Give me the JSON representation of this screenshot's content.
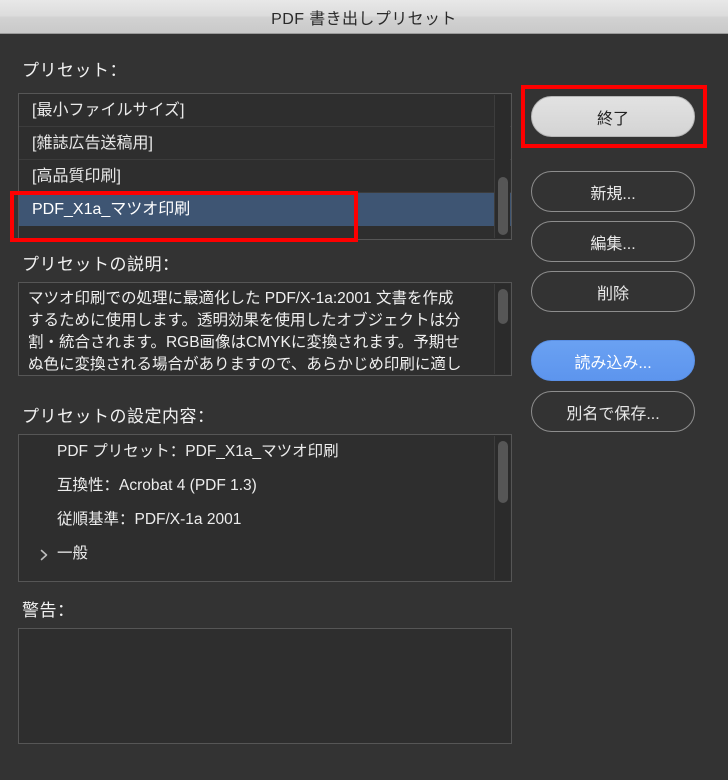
{
  "window": {
    "title": "PDF 書き出しプリセット"
  },
  "presets": {
    "label": "プリセット：",
    "items": [
      {
        "name": "[最小ファイルサイズ]",
        "selected": false
      },
      {
        "name": "[雑誌広告送稿用]",
        "selected": false
      },
      {
        "name": "[高品質印刷]",
        "selected": false
      },
      {
        "name": "PDF_X1a_マツオ印刷",
        "selected": true
      }
    ]
  },
  "description": {
    "label": "プリセットの説明：",
    "lines": [
      "マツオ印刷での処理に最適化した PDF/X-1a:2001 文書を作成",
      "するために使用します。透明効果を使用したオブジェクトは分",
      "割・統合されます。RGB画像はCMYKに変換されます。予期せ",
      "ぬ色に変換される場合がありますので、あらかじめ印刷に適し"
    ]
  },
  "settings": {
    "label": "プリセットの設定内容：",
    "rows": [
      {
        "text": "PDF プリセット：PDF_X1a_マツオ印刷",
        "disclosure": false
      },
      {
        "text": "互換性：Acrobat 4 (PDF 1.3)",
        "disclosure": false
      },
      {
        "text": "従順基準：PDF/X-1a 2001",
        "disclosure": false
      },
      {
        "text": "一般",
        "disclosure": true
      }
    ]
  },
  "warning": {
    "label": "警告：",
    "content": ""
  },
  "buttons": {
    "quit": "終了",
    "new": "新規...",
    "edit": "編集...",
    "delete": "削除",
    "import": "読み込み...",
    "save_as": "別名で保存..."
  },
  "colors": {
    "window_bg": "#333333",
    "panel_bg": "#2e2e2e",
    "selection": "#3e5573",
    "accent_button": "#5d95ee",
    "annotation": "#fe0000",
    "titlebar": "#dcdcdc"
  }
}
